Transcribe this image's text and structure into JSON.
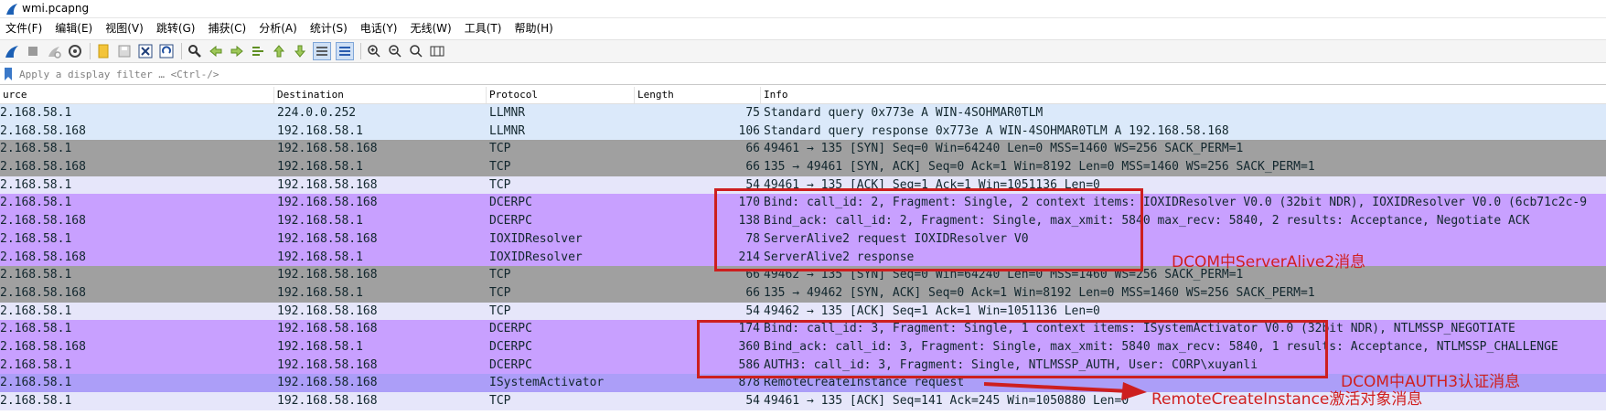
{
  "window": {
    "title": "wmi.pcapng"
  },
  "menu": [
    "文件(F)",
    "编辑(E)",
    "视图(V)",
    "跳转(G)",
    "捕获(C)",
    "分析(A)",
    "统计(S)",
    "电话(Y)",
    "无线(W)",
    "工具(T)",
    "帮助(H)"
  ],
  "toolbar_icons": [
    "shark-fin-start-icon",
    "stop-icon",
    "restart-icon",
    "capture-options-icon",
    "open-file-icon",
    "save-file-icon",
    "close-file-icon",
    "reload-icon",
    "find-packet-icon",
    "go-back-icon",
    "go-forward-icon",
    "go-to-packet-icon",
    "go-first-icon",
    "go-last-icon",
    "auto-scroll-icon",
    "colorize-icon",
    "zoom-in-icon",
    "zoom-out-icon",
    "zoom-reset-icon",
    "resize-columns-icon"
  ],
  "filter": {
    "placeholder": "Apply a display filter … <Ctrl-/>"
  },
  "columns": {
    "source": "urce",
    "destination": "Destination",
    "protocol": "Protocol",
    "length": "Length",
    "info": "Info"
  },
  "colors": {
    "lightblue": "#dbe9fa",
    "gray": "#a0a0a0",
    "lavender": "#e6e6fa",
    "purple": "#c8a0ff",
    "blue_purple": "#ac9ef8",
    "annotation_red": "#cd1f1f"
  },
  "packets": [
    {
      "src": "2.168.58.1",
      "dst": "224.0.0.252",
      "proto": "LLMNR",
      "len": "75",
      "info": "Standard query 0x773e A WIN-4SOHMAR0TLM",
      "color": "lightblue"
    },
    {
      "src": "2.168.58.168",
      "dst": "192.168.58.1",
      "proto": "LLMNR",
      "len": "106",
      "info": "Standard query response 0x773e A WIN-4SOHMAR0TLM A 192.168.58.168",
      "color": "lightblue"
    },
    {
      "src": "2.168.58.1",
      "dst": "192.168.58.168",
      "proto": "TCP",
      "len": "66",
      "info": "49461 → 135 [SYN] Seq=0 Win=64240 Len=0 MSS=1460 WS=256 SACK_PERM=1",
      "color": "gray"
    },
    {
      "src": "2.168.58.168",
      "dst": "192.168.58.1",
      "proto": "TCP",
      "len": "66",
      "info": "135 → 49461 [SYN, ACK] Seq=0 Ack=1 Win=8192 Len=0 MSS=1460 WS=256 SACK_PERM=1",
      "color": "gray"
    },
    {
      "src": "2.168.58.1",
      "dst": "192.168.58.168",
      "proto": "TCP",
      "len": "54",
      "info": "49461 → 135 [ACK] Seq=1 Ack=1 Win=1051136 Len=0",
      "color": "lavender"
    },
    {
      "src": "2.168.58.1",
      "dst": "192.168.58.168",
      "proto": "DCERPC",
      "len": "170",
      "info": "Bind: call_id: 2, Fragment: Single, 2 context items: IOXIDResolver V0.0 (32bit NDR), IOXIDResolver V0.0 (6cb71c2c-9",
      "color": "purple"
    },
    {
      "src": "2.168.58.168",
      "dst": "192.168.58.1",
      "proto": "DCERPC",
      "len": "138",
      "info": "Bind_ack: call_id: 2, Fragment: Single, max_xmit: 5840 max_recv: 5840, 2 results: Acceptance, Negotiate ACK",
      "color": "purple"
    },
    {
      "src": "2.168.58.1",
      "dst": "192.168.58.168",
      "proto": "IOXIDResolver",
      "len": "78",
      "info": "ServerAlive2 request IOXIDResolver V0",
      "color": "purple"
    },
    {
      "src": "2.168.58.168",
      "dst": "192.168.58.1",
      "proto": "IOXIDResolver",
      "len": "214",
      "info": "ServerAlive2 response",
      "color": "purple"
    },
    {
      "src": "2.168.58.1",
      "dst": "192.168.58.168",
      "proto": "TCP",
      "len": "66",
      "info": "49462 → 135 [SYN] Seq=0 Win=64240 Len=0 MSS=1460 WS=256 SACK_PERM=1",
      "color": "gray"
    },
    {
      "src": "2.168.58.168",
      "dst": "192.168.58.1",
      "proto": "TCP",
      "len": "66",
      "info": "135 → 49462 [SYN, ACK] Seq=0 Ack=1 Win=8192 Len=0 MSS=1460 WS=256 SACK_PERM=1",
      "color": "gray"
    },
    {
      "src": "2.168.58.1",
      "dst": "192.168.58.168",
      "proto": "TCP",
      "len": "54",
      "info": "49462 → 135 [ACK] Seq=1 Ack=1 Win=1051136 Len=0",
      "color": "lavender"
    },
    {
      "src": "2.168.58.1",
      "dst": "192.168.58.168",
      "proto": "DCERPC",
      "len": "174",
      "info": "Bind: call_id: 3, Fragment: Single, 1 context items: ISystemActivator V0.0 (32bit NDR), NTLMSSP_NEGOTIATE",
      "color": "purple"
    },
    {
      "src": "2.168.58.168",
      "dst": "192.168.58.1",
      "proto": "DCERPC",
      "len": "360",
      "info": "Bind_ack: call_id: 3, Fragment: Single, max_xmit: 5840 max_recv: 5840, 1 results: Acceptance, NTLMSSP_CHALLENGE",
      "color": "purple"
    },
    {
      "src": "2.168.58.1",
      "dst": "192.168.58.168",
      "proto": "DCERPC",
      "len": "586",
      "info": "AUTH3: call_id: 3, Fragment: Single, NTLMSSP_AUTH, User: CORP\\xuyanli",
      "color": "purple"
    },
    {
      "src": "2.168.58.1",
      "dst": "192.168.58.168",
      "proto": "ISystemActivator",
      "len": "878",
      "info": "RemoteCreateInstance request",
      "color": "blue_purple"
    },
    {
      "src": "2.168.58.1",
      "dst": "192.168.58.168",
      "proto": "TCP",
      "len": "54",
      "info": "49461 → 135 [ACK] Seq=141 Ack=245 Win=1050880 Len=0",
      "color": "lavender"
    }
  ],
  "annotations": {
    "serveralive2": "DCOM中ServerAlive2消息",
    "auth3": "DCOM中AUTH3认证消息",
    "remote_create_instance": "RemoteCreateInstance激活对象消息"
  }
}
